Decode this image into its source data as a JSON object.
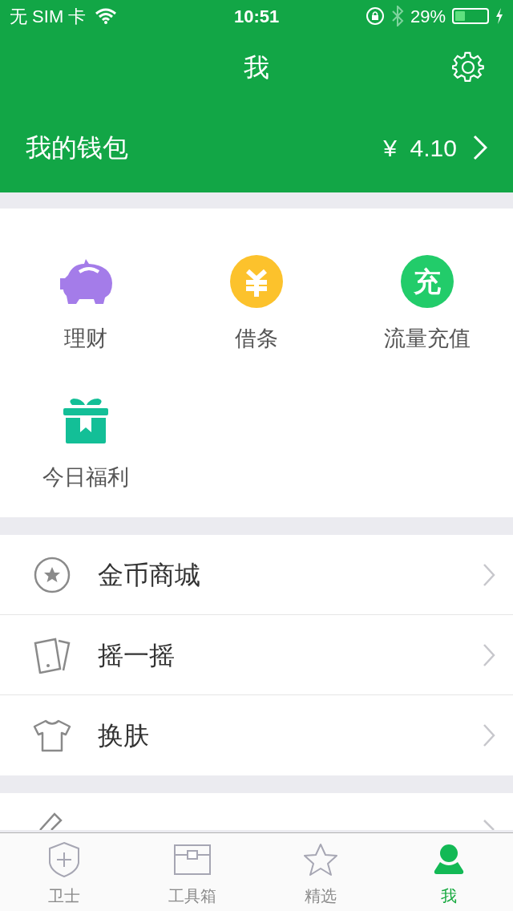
{
  "status_bar": {
    "carrier": "无 SIM 卡",
    "time": "10:51",
    "battery": "29%"
  },
  "header": {
    "title": "我"
  },
  "wallet": {
    "label": "我的钱包",
    "amount": "¥  4.10"
  },
  "services": [
    {
      "kind": "piggy",
      "label": "理财"
    },
    {
      "kind": "yuan",
      "label": "借条"
    },
    {
      "kind": "glyph",
      "glyph": "充",
      "label": "流量充值"
    },
    {
      "kind": "gift",
      "label": "今日福利"
    }
  ],
  "menu_groups": [
    [
      {
        "kind": "coin",
        "label": "金币商城"
      },
      {
        "kind": "shake",
        "label": "摇一摇"
      },
      {
        "kind": "shirt",
        "label": "换肤"
      }
    ],
    [
      {
        "kind": "pencil"
      }
    ]
  ],
  "tab_bar": [
    {
      "kind": "shield",
      "label": "卫士",
      "selected": false
    },
    {
      "kind": "toolbox",
      "label": "工具箱",
      "selected": false
    },
    {
      "kind": "star",
      "label": "精选",
      "selected": false
    },
    {
      "kind": "person",
      "label": "我",
      "selected": true
    }
  ]
}
